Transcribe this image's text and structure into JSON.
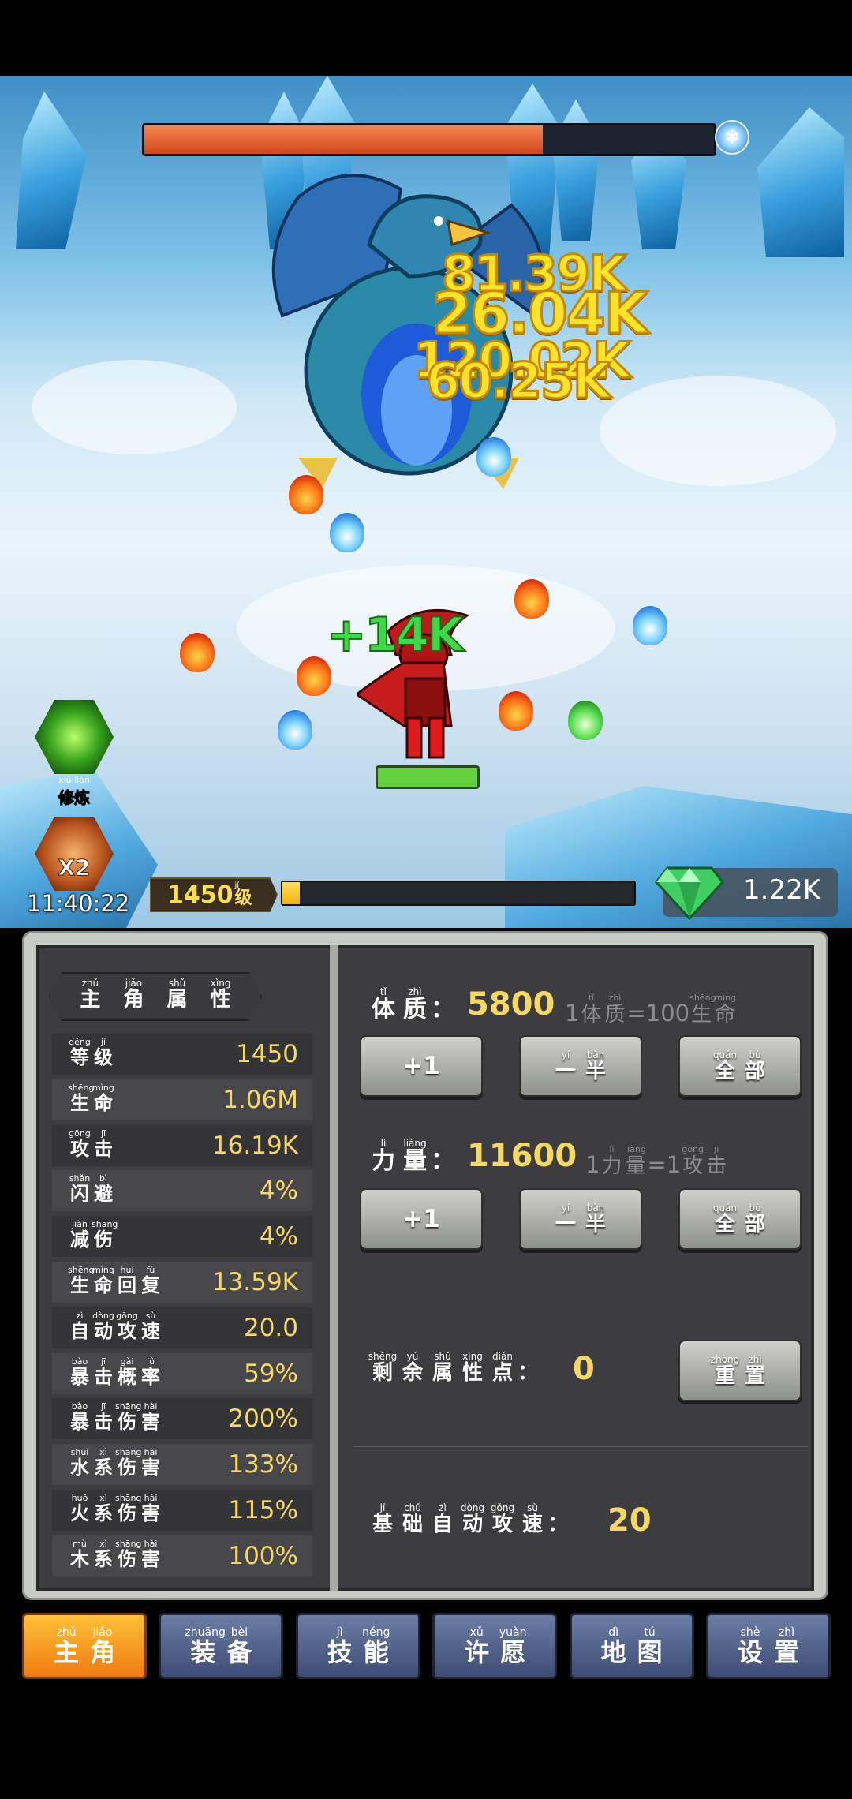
{
  "battle": {
    "damage_numbers": [
      "81.39K",
      "26.04K",
      "120.02K",
      "60.25K"
    ],
    "heal_number": "+14K",
    "boss_hp_fraction": 0.7,
    "timer": "11:40:22",
    "level_value": "1450",
    "level_unit": {
      "py": "jí",
      "ch": "级"
    },
    "xp_fraction": 0.05,
    "gems": "1.22K"
  },
  "side_buttons": {
    "train": {
      "py": "xiū liàn",
      "ch": "修炼"
    },
    "double_badge": "X2"
  },
  "panel": {
    "title": [
      {
        "py": "zhǔ",
        "ch": "主"
      },
      {
        "py": "jiǎo",
        "ch": "角"
      },
      {
        "py": "shǔ",
        "ch": "属"
      },
      {
        "py": "xìng",
        "ch": "性"
      }
    ],
    "stats": [
      {
        "label": [
          {
            "py": "děng",
            "ch": "等"
          },
          {
            "py": "jí",
            "ch": "级"
          }
        ],
        "value": "1450"
      },
      {
        "label": [
          {
            "py": "shēng",
            "ch": "生"
          },
          {
            "py": "mìng",
            "ch": "命"
          }
        ],
        "value": "1.06M"
      },
      {
        "label": [
          {
            "py": "gōng",
            "ch": "攻"
          },
          {
            "py": "jī",
            "ch": "击"
          }
        ],
        "value": "16.19K"
      },
      {
        "label": [
          {
            "py": "shǎn",
            "ch": "闪"
          },
          {
            "py": "bì",
            "ch": "避"
          }
        ],
        "value": "4%"
      },
      {
        "label": [
          {
            "py": "jiǎn",
            "ch": "减"
          },
          {
            "py": "shāng",
            "ch": "伤"
          }
        ],
        "value": "4%"
      },
      {
        "label": [
          {
            "py": "shēng",
            "ch": "生"
          },
          {
            "py": "mìng",
            "ch": "命"
          },
          {
            "py": "huí",
            "ch": "回"
          },
          {
            "py": "fù",
            "ch": "复"
          }
        ],
        "value": "13.59K"
      },
      {
        "label": [
          {
            "py": "zì",
            "ch": "自"
          },
          {
            "py": "dòng",
            "ch": "动"
          },
          {
            "py": "gōng",
            "ch": "攻"
          },
          {
            "py": "sù",
            "ch": "速"
          }
        ],
        "value": "20.0"
      },
      {
        "label": [
          {
            "py": "bào",
            "ch": "暴"
          },
          {
            "py": "jī",
            "ch": "击"
          },
          {
            "py": "gài",
            "ch": "概"
          },
          {
            "py": "lǜ",
            "ch": "率"
          }
        ],
        "value": "59%"
      },
      {
        "label": [
          {
            "py": "bào",
            "ch": "暴"
          },
          {
            "py": "jī",
            "ch": "击"
          },
          {
            "py": "shāng",
            "ch": "伤"
          },
          {
            "py": "hài",
            "ch": "害"
          }
        ],
        "value": "200%"
      },
      {
        "label": [
          {
            "py": "shuǐ",
            "ch": "水"
          },
          {
            "py": "xì",
            "ch": "系"
          },
          {
            "py": "shāng",
            "ch": "伤"
          },
          {
            "py": "hài",
            "ch": "害"
          }
        ],
        "value": "133%"
      },
      {
        "label": [
          {
            "py": "huǒ",
            "ch": "火"
          },
          {
            "py": "xì",
            "ch": "系"
          },
          {
            "py": "shāng",
            "ch": "伤"
          },
          {
            "py": "hài",
            "ch": "害"
          }
        ],
        "value": "115%"
      },
      {
        "label": [
          {
            "py": "mù",
            "ch": "木"
          },
          {
            "py": "xì",
            "ch": "系"
          },
          {
            "py": "shāng",
            "ch": "伤"
          },
          {
            "py": "hài",
            "ch": "害"
          }
        ],
        "value": "100%"
      }
    ],
    "constitution": {
      "label": [
        {
          "py": "tǐ",
          "ch": "体"
        },
        {
          "py": "zhì",
          "ch": "质"
        }
      ],
      "colon": "：",
      "value": "5800",
      "hint_num": "1",
      "hint_mid": [
        {
          "py": "tǐ",
          "ch": "体"
        },
        {
          "py": "zhì",
          "ch": "质"
        }
      ],
      "hint_eq": "=100",
      "hint_end": [
        {
          "py": "shēng",
          "ch": "生"
        },
        {
          "py": "mìng",
          "ch": "命"
        }
      ]
    },
    "strength": {
      "label": [
        {
          "py": "lì",
          "ch": "力"
        },
        {
          "py": "liàng",
          "ch": "量"
        }
      ],
      "colon": "：",
      "value": "11600",
      "hint_num": "1",
      "hint_mid": [
        {
          "py": "lì",
          "ch": "力"
        },
        {
          "py": "liàng",
          "ch": "量"
        }
      ],
      "hint_eq": "=1",
      "hint_end": [
        {
          "py": "gōng",
          "ch": "攻"
        },
        {
          "py": "jī",
          "ch": "击"
        }
      ]
    },
    "buttons": {
      "plus_one": "+1",
      "half": [
        {
          "py": "yí",
          "ch": "一"
        },
        {
          "py": "bàn",
          "ch": "半"
        }
      ],
      "all": [
        {
          "py": "quán",
          "ch": "全"
        },
        {
          "py": "bù",
          "ch": "部"
        }
      ],
      "reset": [
        {
          "py": "zhòng",
          "ch": "重"
        },
        {
          "py": "zhì",
          "ch": "置"
        }
      ]
    },
    "remaining_points": {
      "label": [
        {
          "py": "shèng",
          "ch": "剩"
        },
        {
          "py": "yú",
          "ch": "余"
        },
        {
          "py": "shǔ",
          "ch": "属"
        },
        {
          "py": "xìng",
          "ch": "性"
        },
        {
          "py": "diǎn",
          "ch": "点"
        }
      ],
      "colon": "：",
      "value": "0"
    },
    "base_attack_speed": {
      "label": [
        {
          "py": "jī",
          "ch": "基"
        },
        {
          "py": "chǔ",
          "ch": "础"
        },
        {
          "py": "zì",
          "ch": "自"
        },
        {
          "py": "dòng",
          "ch": "动"
        },
        {
          "py": "gōng",
          "ch": "攻"
        },
        {
          "py": "sù",
          "ch": "速"
        }
      ],
      "colon": "：",
      "value": "20"
    }
  },
  "nav": [
    {
      "key": "hero",
      "label": [
        {
          "py": "zhǔ",
          "ch": "主"
        },
        {
          "py": "jiǎo",
          "ch": "角"
        }
      ],
      "active": true
    },
    {
      "key": "equipment",
      "label": [
        {
          "py": "zhuāng",
          "ch": "装"
        },
        {
          "py": "bèi",
          "ch": "备"
        }
      ],
      "active": false
    },
    {
      "key": "skills",
      "label": [
        {
          "py": "jì",
          "ch": "技"
        },
        {
          "py": "néng",
          "ch": "能"
        }
      ],
      "active": false
    },
    {
      "key": "wish",
      "label": [
        {
          "py": "xǔ",
          "ch": "许"
        },
        {
          "py": "yuàn",
          "ch": "愿"
        }
      ],
      "active": false
    },
    {
      "key": "map",
      "label": [
        {
          "py": "dì",
          "ch": "地"
        },
        {
          "py": "tú",
          "ch": "图"
        }
      ],
      "active": false
    },
    {
      "key": "settings",
      "label": [
        {
          "py": "shè",
          "ch": "设"
        },
        {
          "py": "zhì",
          "ch": "置"
        }
      ],
      "active": false
    }
  ],
  "colors": {
    "accent": "#f7d865",
    "nav_active": "#f7961e",
    "nav_idle": "#4a5a82",
    "heal": "#3fd84a",
    "damage": "#ffe32a"
  }
}
